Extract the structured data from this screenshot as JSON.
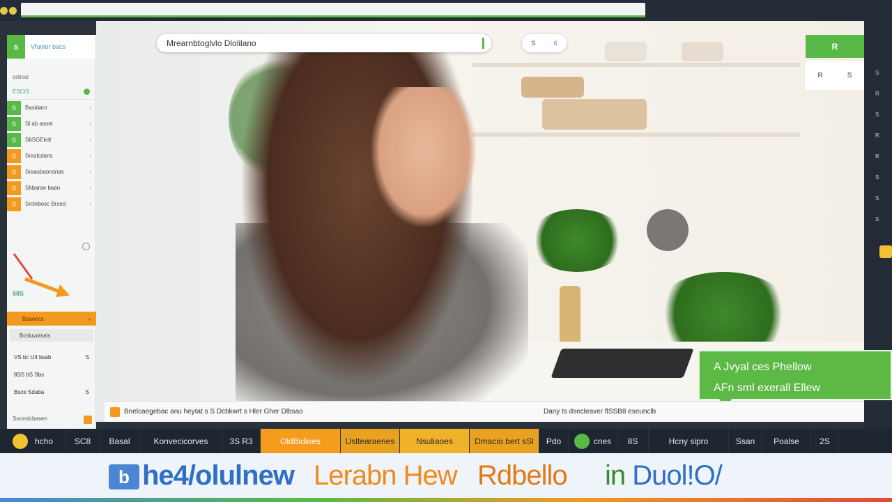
{
  "browser": {
    "url": ""
  },
  "search": {
    "value": "Mrearnbtoglvlo Dlolilano"
  },
  "pill": {
    "left": "S",
    "right": "6"
  },
  "sidebar": {
    "brand": "Vfuvtor bacs",
    "heading": "ssbosr",
    "section_label": "ESCIS",
    "items": [
      {
        "icon": "S",
        "label": "Basldaro",
        "color": "#58b947"
      },
      {
        "icon": "S",
        "label": "Sl ab asoel",
        "color": "#58b947"
      },
      {
        "icon": "S",
        "label": "SbSGEkdt",
        "color": "#58b947"
      },
      {
        "icon": "S",
        "label": "Sraslcdans",
        "color": "#f29a1f"
      },
      {
        "icon": "S",
        "label": "Sraasbaonsnas",
        "color": "#f29a1f"
      },
      {
        "icon": "S",
        "label": "Shbarae baan",
        "color": "#f29a1f"
      },
      {
        "icon": "S",
        "label": "Srclebosc Brsed",
        "color": "#f29a1f"
      }
    ],
    "count": "58S",
    "orange_label": "Bsaoecs",
    "sub_label": "Bcsluvotsals",
    "list2": [
      {
        "label": "VS bc UII bsab",
        "value": "S"
      },
      {
        "label": "8SS bS Sbs",
        "value": ""
      },
      {
        "label": "Bsce Sdaba",
        "value": "S"
      }
    ],
    "footer": "Soceslcbasen"
  },
  "right": {
    "green_label": "R",
    "white_left": "R",
    "white_right": "S",
    "rail": [
      "S",
      "R",
      "S",
      "R",
      "R",
      "S",
      "S",
      "S"
    ]
  },
  "callout": {
    "line1": "A Jvyal ces Phellow",
    "line2": "AFn sml exerall Ellew"
  },
  "caption": {
    "left": "Bnelcaegebac anu heytat s S Dcbkwrt s Hler Gher Dlbsao",
    "right": "Dany ts dsecleaver flSSB8 eseunclb"
  },
  "toolbar": [
    {
      "label": "hcho",
      "style": "dark",
      "dot": "yellow",
      "width": 95
    },
    {
      "label": "SC8",
      "style": "dark",
      "width": 48
    },
    {
      "label": "Basal",
      "style": "dark",
      "width": 58
    },
    {
      "label": "Konvecicorves",
      "style": "dark",
      "width": 118
    },
    {
      "label": "3S R3",
      "style": "dark",
      "width": 55
    },
    {
      "label": "OldBidioes",
      "style": "o1",
      "width": 115
    },
    {
      "label": "Usltearaenes",
      "style": "o2",
      "width": 85
    },
    {
      "label": "Nsuliaoes",
      "style": "o3",
      "width": 100
    },
    {
      "label": "Dmacio bert sSl",
      "style": "o2",
      "width": 100
    },
    {
      "label": "Pdo",
      "style": "dark",
      "width": 42
    },
    {
      "label": "cnes",
      "style": "dark",
      "dot": "green",
      "width": 70
    },
    {
      "label": "8S",
      "style": "dark",
      "width": 45
    },
    {
      "label": "Hcny sipro",
      "style": "dark",
      "width": 115
    },
    {
      "label": "Ssan",
      "style": "dark",
      "width": 48
    },
    {
      "label": "Poalse",
      "style": "dark",
      "width": 70
    },
    {
      "label": "2S",
      "style": "dark",
      "width": 40
    }
  ],
  "banner": {
    "icon": "b",
    "word1": "he4/olulnew",
    "word2": "Lerabn Hew",
    "word3": "Rdbello",
    "word4_a": "in ",
    "word4_b": "Duol!O/"
  },
  "colors": {
    "accent_green": "#58b947",
    "accent_orange": "#f29a1f",
    "accent_blue": "#4a86d4"
  }
}
